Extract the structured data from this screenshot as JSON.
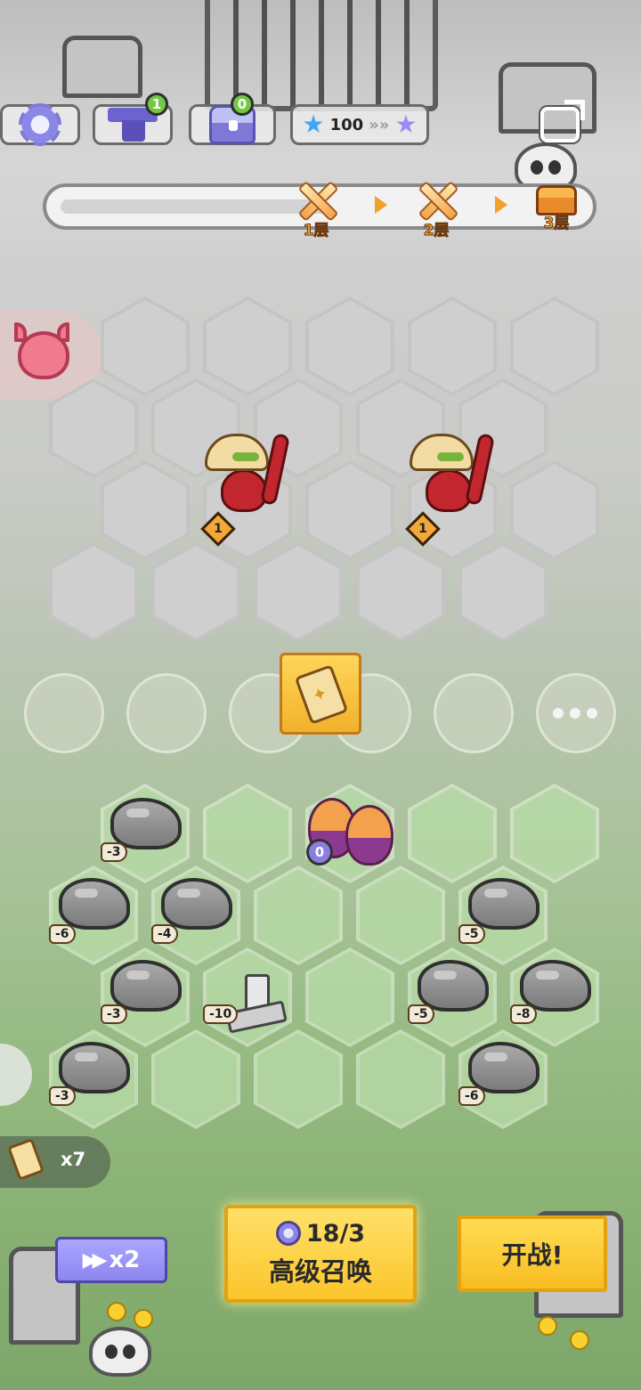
{
  "hud": {
    "forge_badge": "1",
    "chest_badge": "0",
    "star_count": "100"
  },
  "progress": {
    "stages": [
      {
        "label": "1层",
        "type": "battle",
        "current": true
      },
      {
        "label": "2层",
        "type": "battle",
        "current": false
      },
      {
        "label": "3层",
        "type": "treasure",
        "current": false
      }
    ]
  },
  "enemies": [
    {
      "name": "taco-pepper",
      "level": "1"
    },
    {
      "name": "taco-pepper",
      "level": "1"
    }
  ],
  "egg": {
    "count": "0"
  },
  "obstacles": [
    {
      "kind": "rock",
      "value": "-3"
    },
    {
      "kind": "rock",
      "value": "-6"
    },
    {
      "kind": "rock",
      "value": "-4"
    },
    {
      "kind": "rock",
      "value": "-5"
    },
    {
      "kind": "rock",
      "value": "-3"
    },
    {
      "kind": "ruin",
      "value": "-10"
    },
    {
      "kind": "rock",
      "value": "-5"
    },
    {
      "kind": "rock",
      "value": "-8"
    },
    {
      "kind": "rock",
      "value": "-3"
    },
    {
      "kind": "rock",
      "value": "-6"
    }
  ],
  "bottom": {
    "scroll_count": "x7",
    "speed_label": "x2",
    "summon_cost": "18/3",
    "summon_label": "高级召唤",
    "fight_label": "开战!"
  },
  "colors": {
    "accent_gold": "#f0a02b",
    "button_yellow": "#fbc52b",
    "speed_purple": "#8d86f0",
    "badge_green": "#72c943"
  }
}
